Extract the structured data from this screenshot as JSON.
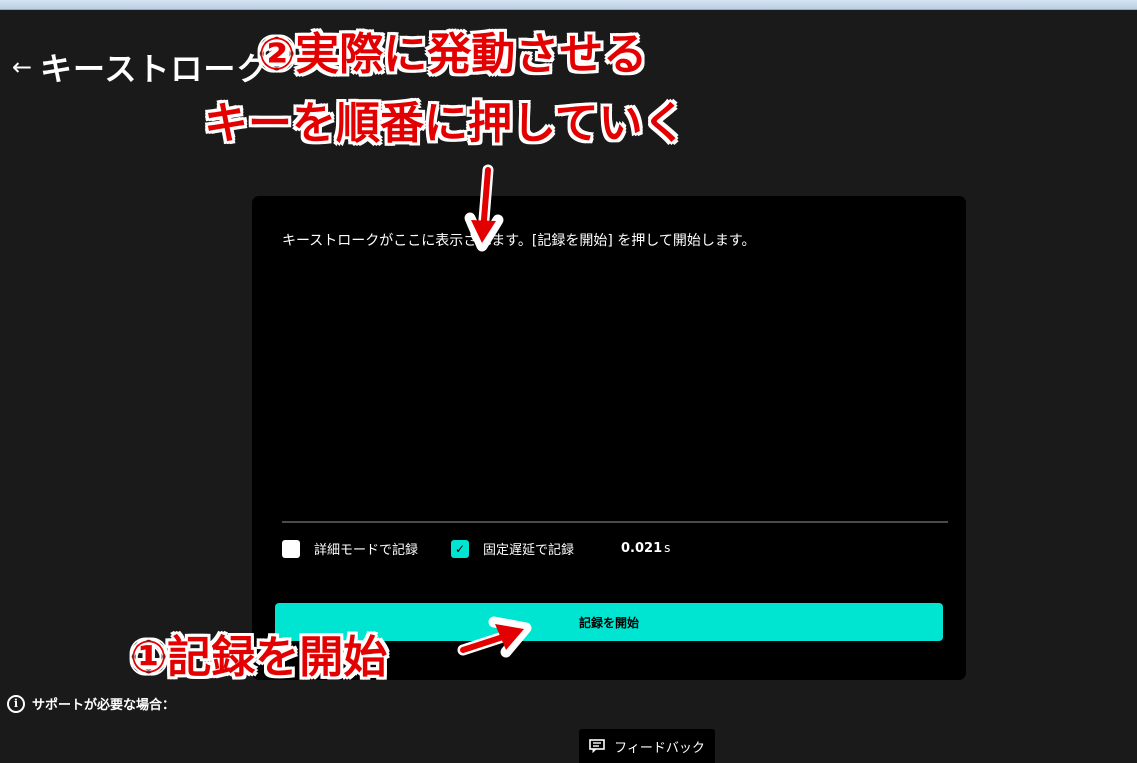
{
  "header": {
    "back_icon": "left-arrow-icon",
    "title": "キーストローク"
  },
  "panel": {
    "placeholder_text": "キーストロークがここに表示されます。[記録を開始] を押して開始します。",
    "options": {
      "detailed_mode": {
        "label": "詳細モードで記録",
        "checked": false
      },
      "fixed_delay": {
        "label": "固定遅延で記録",
        "checked": true
      }
    },
    "delay": {
      "value": "0.021",
      "unit": "s"
    },
    "start_button_label": "記録を開始"
  },
  "support": {
    "icon": "info-icon",
    "text": "サポートが必要な場合："
  },
  "feedback": {
    "icon": "feedback-icon",
    "label": "フィードバック"
  },
  "annotations": {
    "step2_line1": "②実際に発動させる",
    "step2_line2": "キーを順番に押していく",
    "step1": "①記録を開始"
  },
  "colors": {
    "background": "#1a1a1a",
    "panel": "#000000",
    "accent": "#00e5d1",
    "annotation_red": "#e30000"
  }
}
